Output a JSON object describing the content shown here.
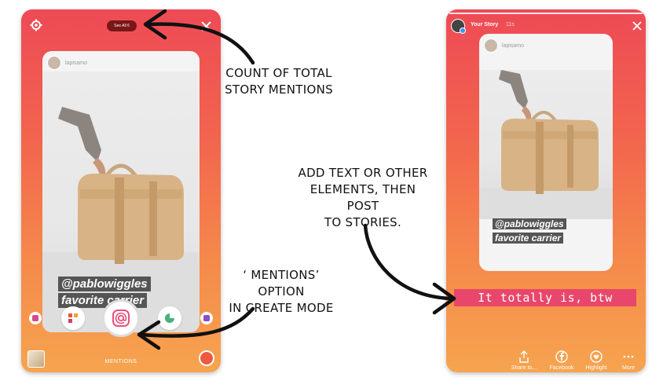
{
  "left_screen": {
    "see_all_label": "See All 6",
    "card_username": "lapisamo",
    "tag_text": [
      "@pablowiggles",
      "favorite carrier"
    ],
    "mode_label": "MENTIONS"
  },
  "right_screen": {
    "story_title": "Your Story",
    "story_time": "11s",
    "card_username": "lapisamo",
    "tag_text": [
      "@pablowiggles",
      "favorite carrier"
    ],
    "added_text": "It totally is, btw",
    "bottom_actions": [
      "Share to...",
      "Facebook",
      "Highlight",
      "More"
    ]
  },
  "annotations": {
    "count": [
      "COUNT OF TOTAL",
      "STORY MENTIONS"
    ],
    "add_text": [
      "ADD TEXT OR OTHER",
      "ELEMENTS, THEN POST",
      "TO STORIES."
    ],
    "mentions_option": [
      "‘ MENTIONS’ OPTION",
      "IN CREATE MODE"
    ]
  },
  "colors": {
    "gradient_top": "#ee4a55",
    "gradient_bottom": "#f6a44f",
    "text_highlight": "#e8466a",
    "tag_bg": "#555555",
    "mention_accent": "#e9507a"
  },
  "icons": [
    "gear-icon",
    "close-icon",
    "mention-at-icon",
    "share-icon",
    "facebook-icon",
    "highlight-heart-icon",
    "more-dots-icon"
  ]
}
